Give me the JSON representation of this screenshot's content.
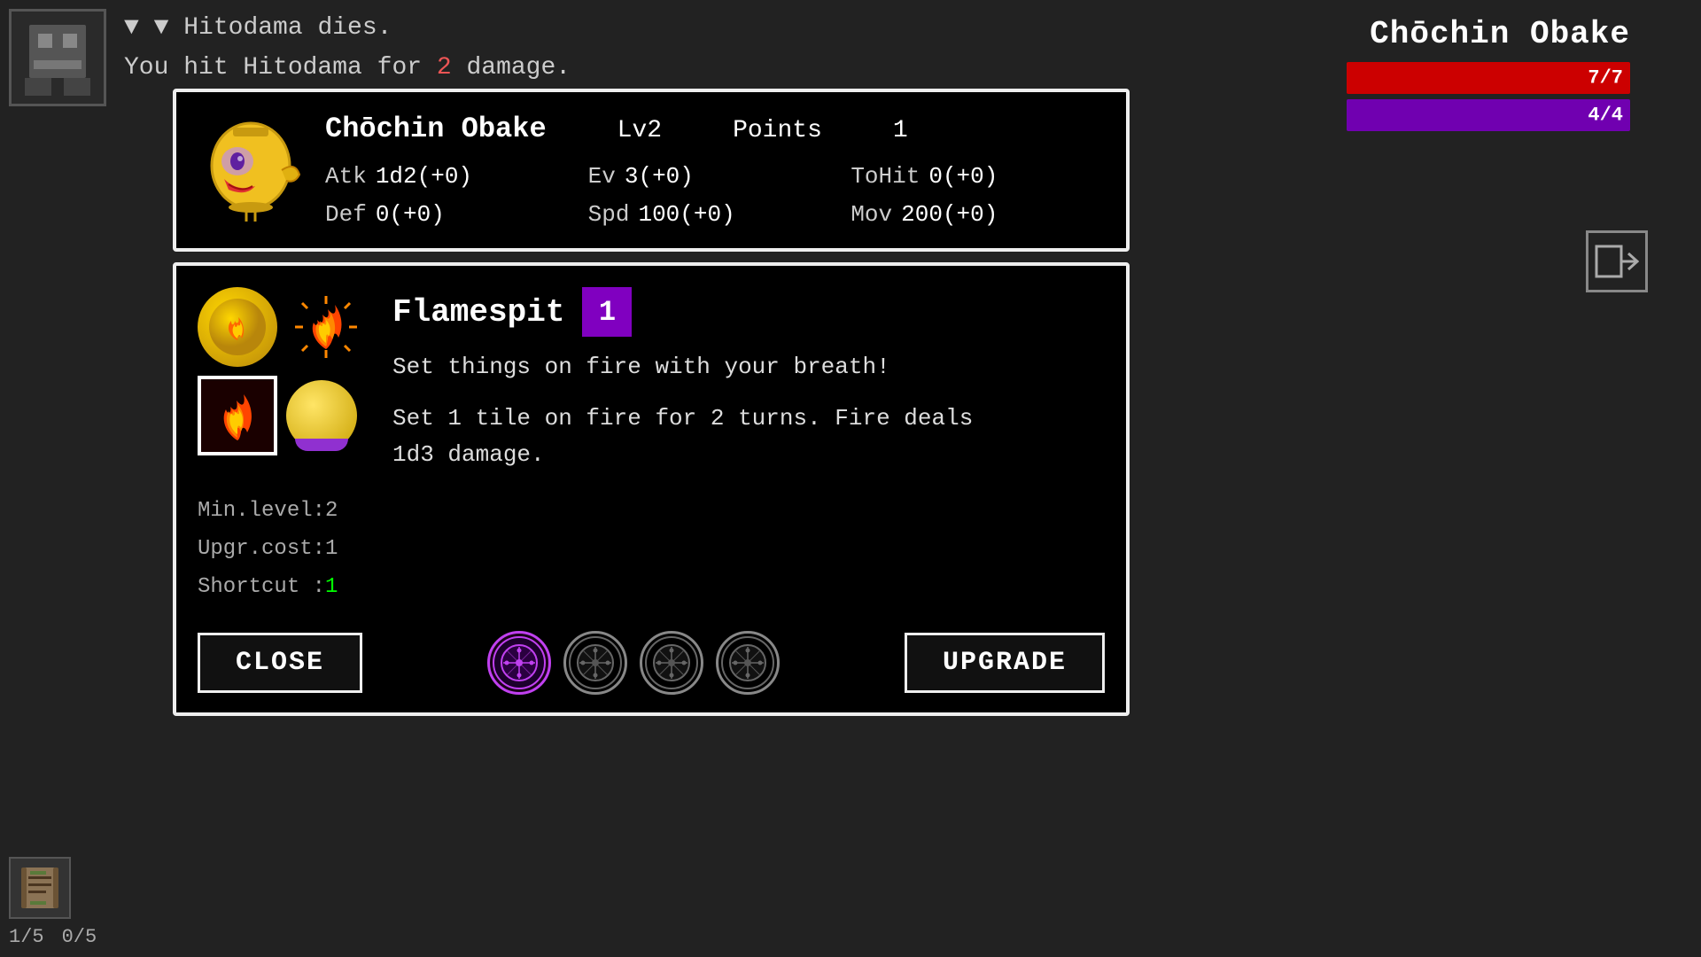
{
  "background": {
    "color": "#1a1a1a"
  },
  "combat_log": {
    "line1": "▼ Hitodama dies.",
    "line2_prefix": "You hit Hitodama for ",
    "line2_damage": "2",
    "line2_suffix": " damage."
  },
  "top_right": {
    "enemy_name": "Chōchin Obake",
    "hp": "7/7",
    "mp": "4/4"
  },
  "stat_panel": {
    "char_name": "Chōchin Obake",
    "level_label": "Lv2",
    "points_label": "Points",
    "points_value": "1",
    "atk_label": "Atk",
    "atk_value": "1d2(+0)",
    "ev_label": "Ev",
    "ev_value": "3(+0)",
    "tohit_label": "ToHit",
    "tohit_value": "0(+0)",
    "def_label": "Def",
    "def_value": "0(+0)",
    "spd_label": "Spd",
    "spd_value": "100(+0)",
    "mov_label": "Mov",
    "mov_value": "200(+0)"
  },
  "ability_panel": {
    "name": "Flamespit",
    "level": "1",
    "description": "Set things on fire with your breath!",
    "details_line1": "Set 1 tile on fire for 2 turns. Fire deals",
    "details_line2": "1d3 damage.",
    "min_level_label": "Min.level:",
    "min_level_value": "2",
    "upgr_cost_label": "Upgr.cost:",
    "upgr_cost_value": "1",
    "shortcut_label": "Shortcut :",
    "shortcut_value": "1"
  },
  "buttons": {
    "close_label": "CLOSE",
    "upgrade_label": "UPGRADE"
  },
  "inventory": {
    "count1": "1/5",
    "count2": "0/5"
  }
}
